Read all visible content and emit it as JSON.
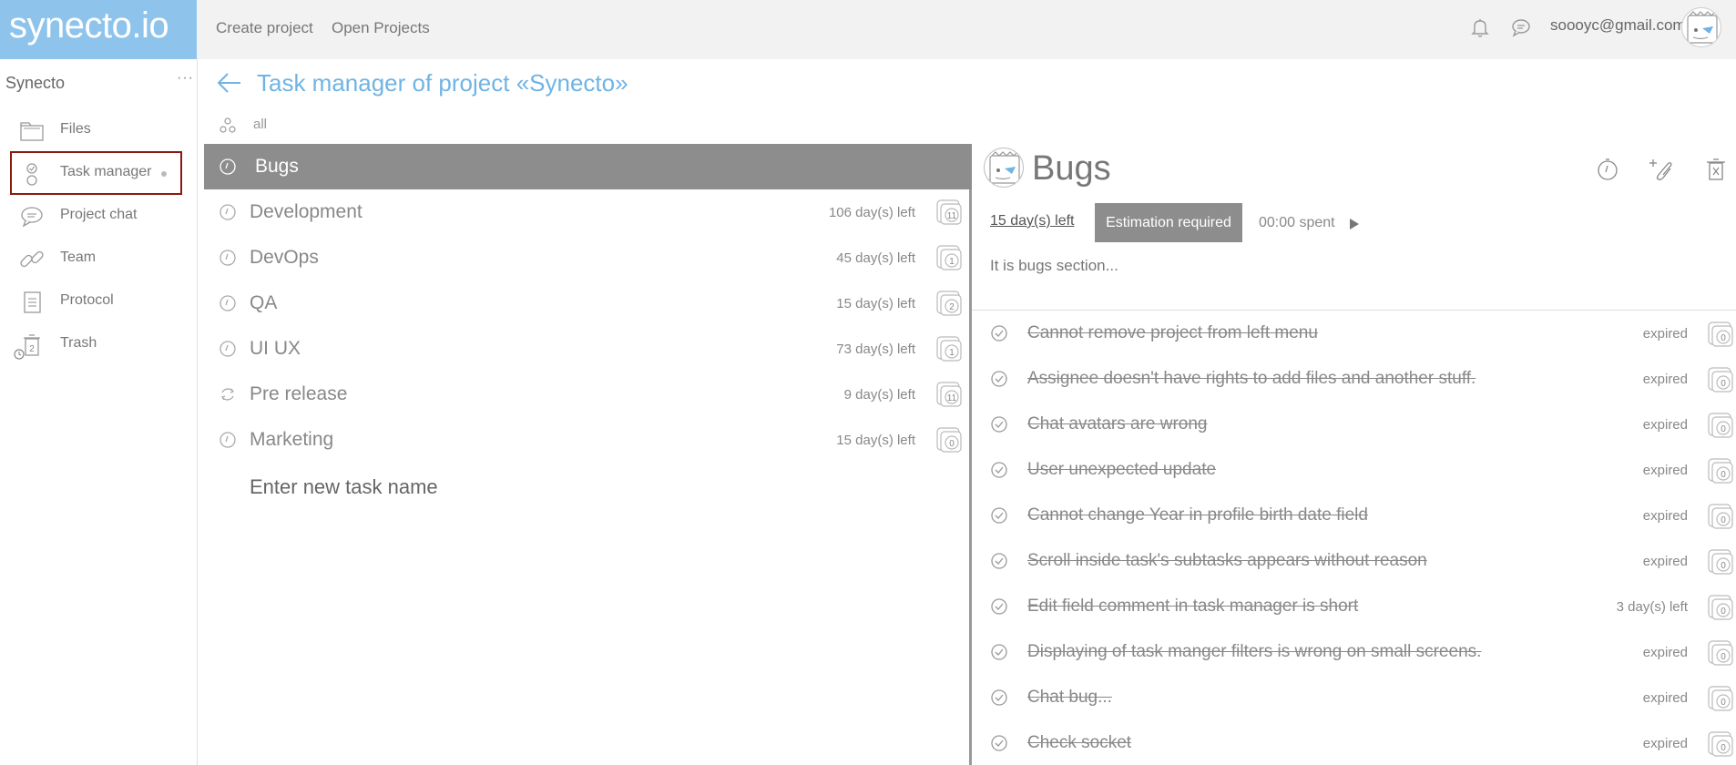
{
  "app": {
    "logo": "synecto.io",
    "nav": {
      "create_project": "Create project",
      "open_projects": "Open Projects"
    },
    "user_email": "soooyc@gmail.com"
  },
  "sidebar": {
    "project_name": "Synecto",
    "more": "···",
    "items": [
      {
        "label": "Files",
        "icon": "folder-icon"
      },
      {
        "label": "Task manager",
        "icon": "task-manager-icon"
      },
      {
        "label": "Project chat",
        "icon": "chat-icon"
      },
      {
        "label": "Team",
        "icon": "link-icon"
      },
      {
        "label": "Protocol",
        "icon": "document-icon"
      },
      {
        "label": "Trash",
        "icon": "trash-icon",
        "count": "2"
      }
    ]
  },
  "main": {
    "title": "Task manager of project «Synecto»",
    "filter_label": "all",
    "tasks": [
      {
        "name": "Bugs",
        "days_left": "",
        "count": "",
        "selected": true
      },
      {
        "name": "Development",
        "days_left": "106 day(s) left",
        "count": "11"
      },
      {
        "name": "DevOps",
        "days_left": "45 day(s) left",
        "count": "1"
      },
      {
        "name": "QA",
        "days_left": "15 day(s) left",
        "count": "2"
      },
      {
        "name": "UI UX",
        "days_left": "73 day(s) left",
        "count": "1"
      },
      {
        "name": "Pre release",
        "days_left": "9 day(s) left",
        "count": "11"
      },
      {
        "name": "Marketing",
        "days_left": "15 day(s) left",
        "count": "0"
      }
    ],
    "new_task_placeholder": "Enter new task name"
  },
  "detail": {
    "title": "Bugs",
    "days_left": "15 day(s) left",
    "estimation": "Estimation required",
    "spent": "00:00 spent",
    "description": "It is bugs section...",
    "subtasks": [
      {
        "name": "Cannot remove project from left menu",
        "status": "expired",
        "count": "0"
      },
      {
        "name": "Assignee doesn't have rights to add files and another stuff.",
        "status": "expired",
        "count": "0"
      },
      {
        "name": "Chat avatars are wrong",
        "status": "expired",
        "count": "0"
      },
      {
        "name": "User unexpected update",
        "status": "expired",
        "count": "0"
      },
      {
        "name": "Cannot change Year in profile birth date field",
        "status": "expired",
        "count": "0"
      },
      {
        "name": "Scroll inside task's subtasks appears without reason",
        "status": "expired",
        "count": "0"
      },
      {
        "name": "Edit field comment in task manager is short",
        "status": "3 day(s) left",
        "count": "0"
      },
      {
        "name": "Displaying of task manger filters is wrong on small screens.",
        "status": "expired",
        "count": "0"
      },
      {
        "name": "Chat bug...",
        "status": "expired",
        "count": "0"
      },
      {
        "name": "Check socket",
        "status": "expired",
        "count": "0"
      }
    ]
  },
  "colors": {
    "logo_bg": "#8ec4ec",
    "title": "#6fb4e4",
    "selected_row": "#8d8d8d",
    "active_outline": "#8b1a0e"
  }
}
